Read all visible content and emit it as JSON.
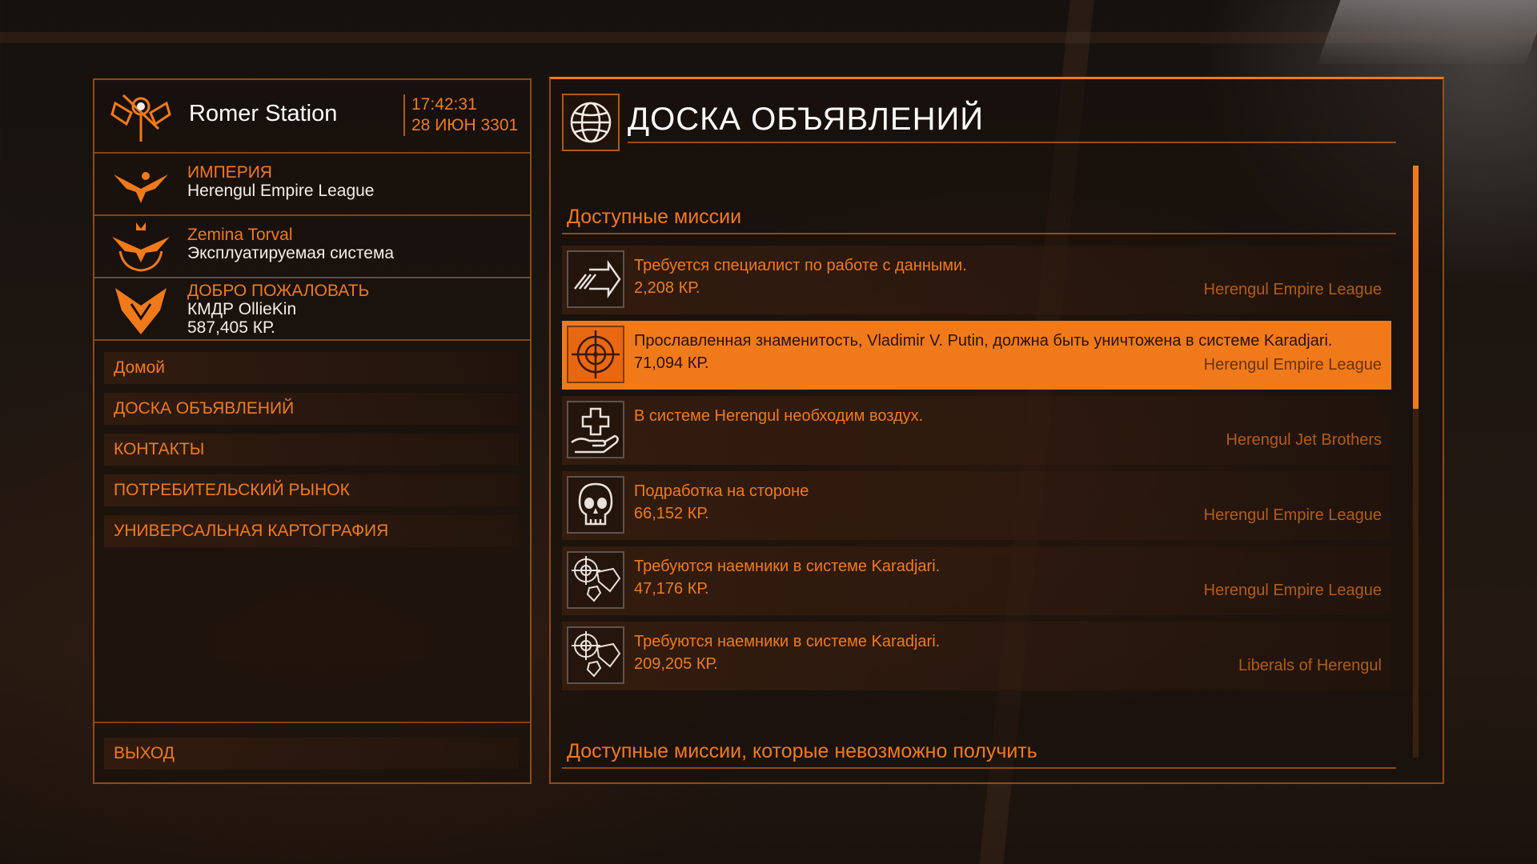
{
  "station": {
    "name": "Romer Station",
    "time": "17:42:31",
    "date": "28 ИЮН 3301"
  },
  "allegiance": {
    "label": "ИМПЕРИЯ",
    "value": "Herengul Empire League"
  },
  "government": {
    "label": "Zemina Torval",
    "value": "Эксплуатируемая система"
  },
  "welcome": {
    "label": "ДОБРО ПОЖАЛОВАТЬ",
    "commander": "КМДР OllieKin",
    "credits": "587,405 КР."
  },
  "menu": {
    "items": [
      {
        "label": "Домой"
      },
      {
        "label": "ДОСКА ОБЪЯВЛЕНИЙ"
      },
      {
        "label": "КОНТАКТЫ"
      },
      {
        "label": "ПОТРЕБИТЕЛЬСКИЙ РЫНОК"
      },
      {
        "label": "УНИВЕРСАЛЬНАЯ КАРТОГРАФИЯ"
      }
    ],
    "exit_label": "ВЫХОД"
  },
  "board": {
    "title": "ДОСКА ОБЪЯВЛЕНИЙ",
    "available_title": "Доступные миссии",
    "unavailable_title": "Доступные миссии, которые невозможно получить",
    "missions": [
      {
        "icon": "data-transfer-arrow-icon",
        "title": "Требуется специалист по работе с данными.",
        "reward": "2,208 КР.",
        "faction": "Herengul Empire League",
        "selected": false
      },
      {
        "icon": "crosshair-target-icon",
        "title": "Прославленная знаменитость, Vladimir V. Putin, должна быть уничтожена в системе Karadjari.",
        "reward": "71,094 КР.",
        "faction": "Herengul Empire League",
        "selected": true
      },
      {
        "icon": "aid-hand-icon",
        "title": "В системе Herengul необходим воздух.",
        "reward": "",
        "faction": "Herengul Jet Brothers",
        "selected": false
      },
      {
        "icon": "skull-icon",
        "title": "Подработка на стороне",
        "reward": "66,152 КР.",
        "faction": "Herengul Empire League",
        "selected": false
      },
      {
        "icon": "mercenary-target-gems-icon",
        "title": "Требуются наемники в системе Karadjari.",
        "reward": "47,176 КР.",
        "faction": "Herengul Empire League",
        "selected": false
      },
      {
        "icon": "mercenary-target-gems-icon",
        "title": "Требуются наемники в системе Karadjari.",
        "reward": "209,205 КР.",
        "faction": "Liberals of Herengul",
        "selected": false
      }
    ]
  },
  "colors": {
    "accent": "#f07a1a",
    "selected_row": "#f07a1a",
    "panel_bg": "#19100b"
  }
}
